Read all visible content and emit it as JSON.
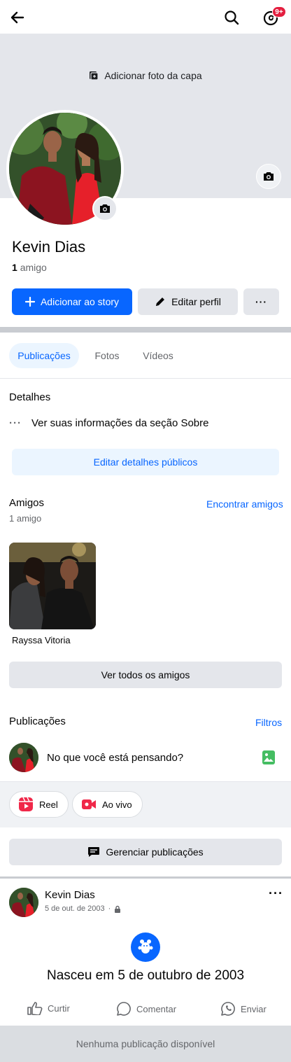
{
  "topbar": {
    "back_icon": "arrow-left-icon",
    "search_icon": "search-icon",
    "notifications_icon": "threads-notifications-icon",
    "notifications_badge": "9+"
  },
  "cover": {
    "add_cover_label": "Adicionar foto da capa"
  },
  "profile": {
    "name": "Kevin Dias",
    "friends_count": "1",
    "friends_label": "amigo"
  },
  "actions": {
    "add_story_label": "Adicionar ao story",
    "edit_profile_label": "Editar perfil",
    "more_label": "···"
  },
  "tabs": [
    {
      "label": "Publicações",
      "active": true
    },
    {
      "label": "Fotos",
      "active": false
    },
    {
      "label": "Vídeos",
      "active": false
    }
  ],
  "details": {
    "title": "Detalhes",
    "about_text": "Ver suas informações da seção Sobre",
    "edit_button": "Editar detalhes públicos"
  },
  "friends": {
    "title": "Amigos",
    "find_link": "Encontrar amigos",
    "count_text": "1 amigo",
    "items": [
      {
        "name": "Rayssa Vitoria"
      }
    ],
    "see_all": "Ver todos os amigos"
  },
  "posts": {
    "title": "Publicações",
    "filters_link": "Filtros",
    "composer_placeholder": "No que você está pensando?",
    "chips": [
      {
        "label": "Reel",
        "icon": "reel-icon"
      },
      {
        "label": "Ao vivo",
        "icon": "live-video-icon"
      }
    ],
    "manage_button": "Gerenciar publicações"
  },
  "post": {
    "author": "Kevin Dias",
    "date": "5 de out. de 2003",
    "separator": "·",
    "more_label": "···",
    "life_event": "Nasceu em 5 de outubro de 2003",
    "actions": [
      {
        "label": "Curtir",
        "icon": "like-icon"
      },
      {
        "label": "Comentar",
        "icon": "comment-icon"
      },
      {
        "label": "Enviar",
        "icon": "whatsapp-icon"
      }
    ]
  },
  "footer": {
    "text": "Nenhuma publicação disponível"
  },
  "colors": {
    "accent": "#0866ff",
    "badge": "#e41e3f",
    "cover_bg": "#e4e6eb"
  }
}
